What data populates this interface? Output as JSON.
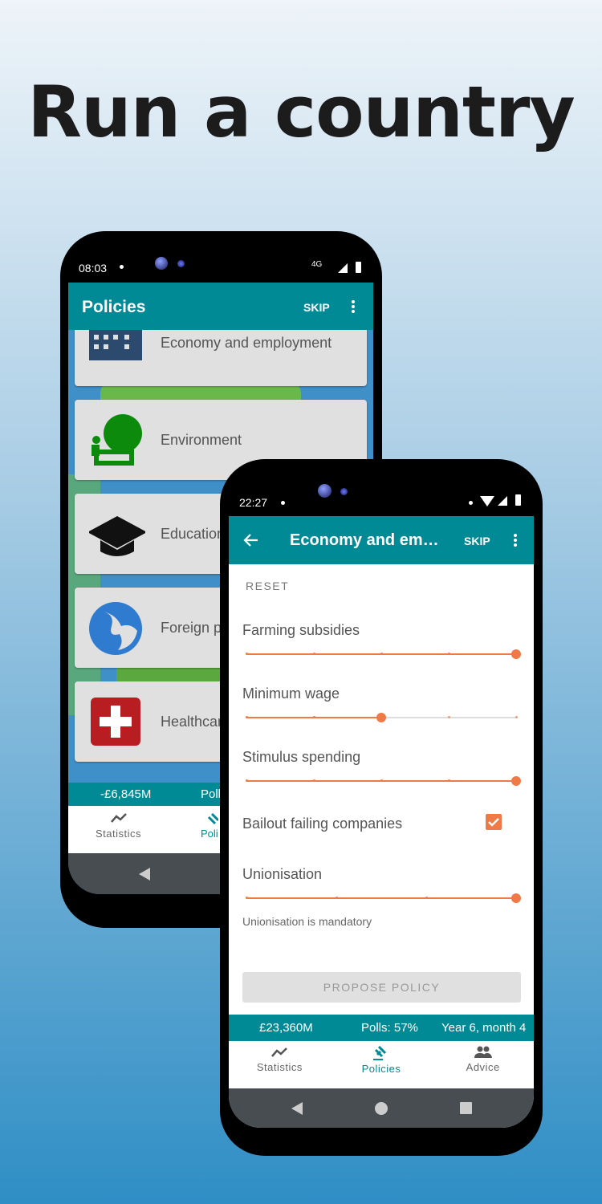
{
  "headline": "Run a country",
  "back_phone": {
    "status": {
      "time": "08:03",
      "network": "4G"
    },
    "appbar": {
      "title": "Policies",
      "skip": "SKIP"
    },
    "categories": [
      {
        "label": "Economy and employment",
        "icon": "building-icon"
      },
      {
        "label": "Environment",
        "icon": "tree-icon"
      },
      {
        "label": "Education",
        "icon": "graduation-cap-icon"
      },
      {
        "label": "Foreign policy",
        "icon": "globe-icon"
      },
      {
        "label": "Healthcare",
        "icon": "medical-cross-icon"
      }
    ],
    "visible_labels": [
      "Economy and employment",
      "Environment",
      "Educatio",
      "Foreign p",
      "Healthca"
    ],
    "info": {
      "budget": "-£6,845M",
      "polls": "Poll"
    },
    "nav": {
      "statistics": "Statistics",
      "policies": "Poli"
    }
  },
  "front_phone": {
    "status": {
      "time": "22:27"
    },
    "appbar": {
      "title": "Economy and em…",
      "skip": "SKIP"
    },
    "reset": "RESET",
    "policies": [
      {
        "label": "Farming subsidies",
        "type": "slider",
        "value": 1.0,
        "stops": 5
      },
      {
        "label": "Minimum wage",
        "type": "slider",
        "value": 0.5,
        "stops": 5
      },
      {
        "label": "Stimulus spending",
        "type": "slider",
        "value": 1.0,
        "stops": 5
      },
      {
        "label": "Bailout failing companies",
        "type": "checkbox",
        "checked": true
      },
      {
        "label": "Unionisation",
        "type": "slider",
        "value": 1.0,
        "stops": 4,
        "description": "Unionisation is mandatory"
      }
    ],
    "propose": "PROPOSE POLICY",
    "info": {
      "budget": "£23,360M",
      "polls": "Polls: 57%",
      "date": "Year 6, month 4"
    },
    "nav": {
      "statistics": "Statistics",
      "policies": "Policies",
      "advice": "Advice"
    }
  },
  "colors": {
    "primary": "#008a95",
    "accent": "#f07a45"
  }
}
